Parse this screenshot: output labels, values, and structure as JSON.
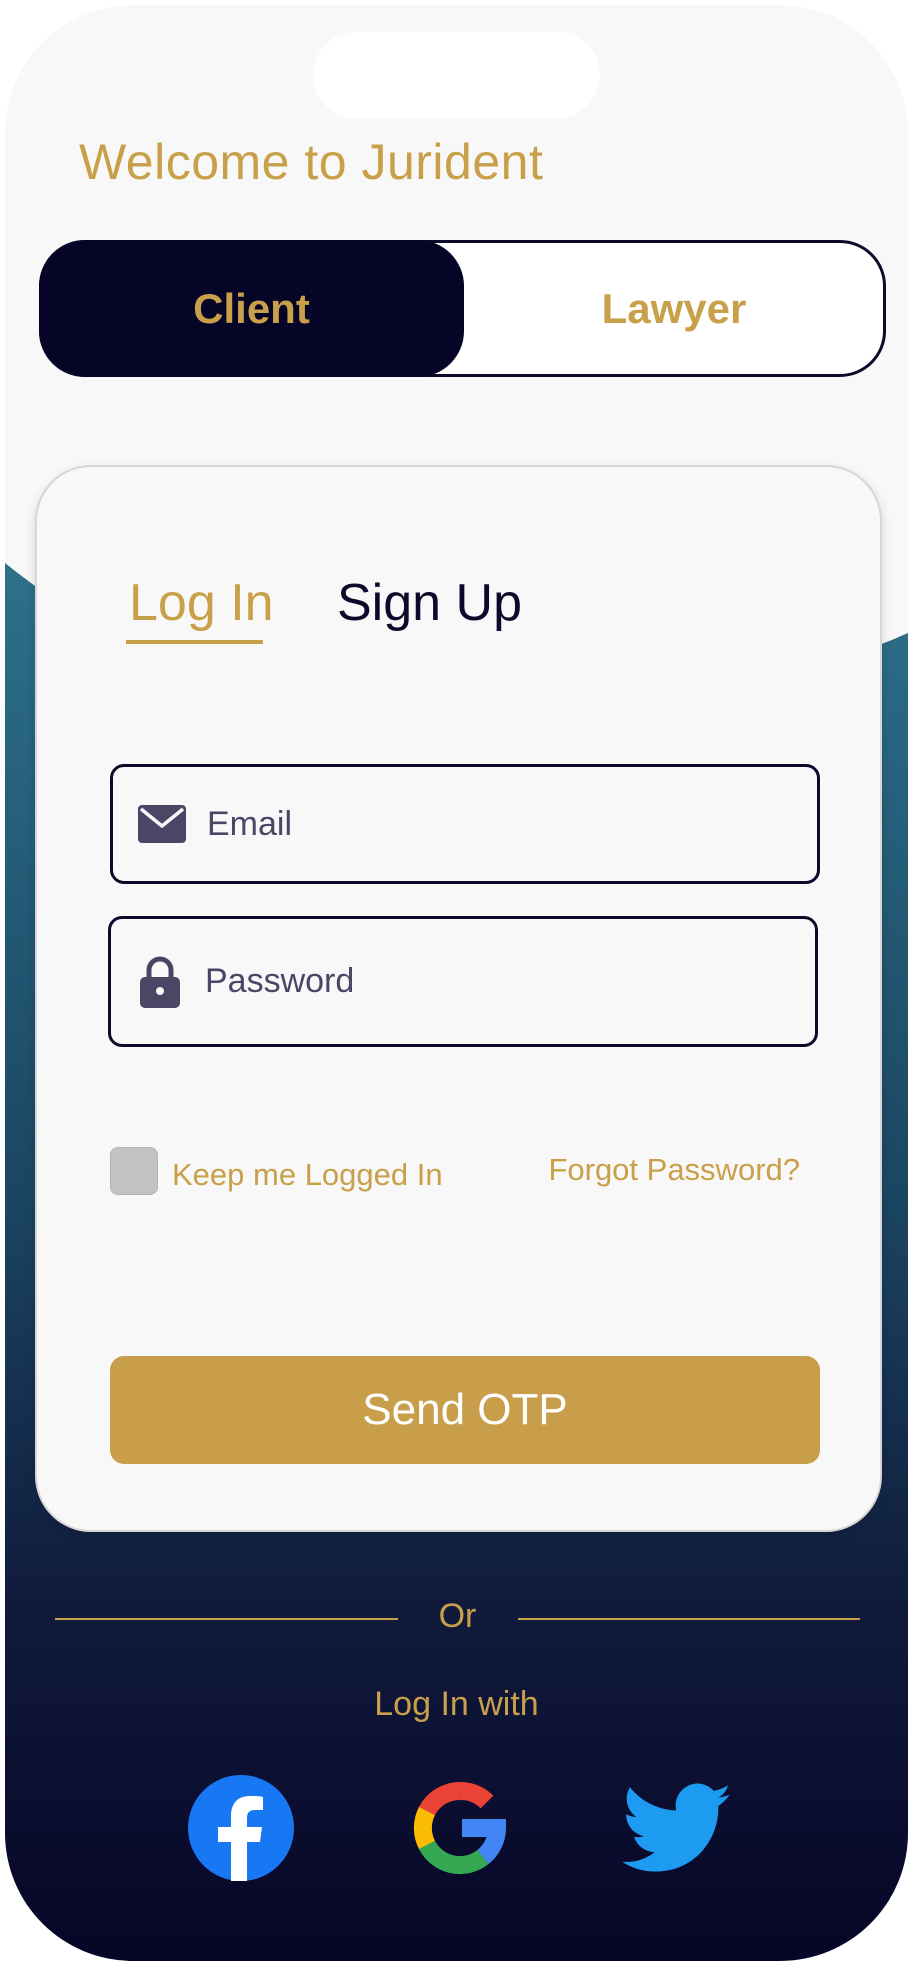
{
  "app": {
    "welcome_title": "Welcome to Jurident"
  },
  "role_switch": {
    "options": [
      {
        "label": "Client",
        "selected": true
      },
      {
        "label": "Lawyer",
        "selected": false
      }
    ]
  },
  "auth_tabs": {
    "login_label": "Log In",
    "signup_label": "Sign Up",
    "active": "Log In"
  },
  "form": {
    "email": {
      "placeholder": "Email",
      "value": "",
      "icon": "mail-icon"
    },
    "password": {
      "placeholder": "Password",
      "value": "",
      "icon": "lock-icon"
    },
    "remember_label": "Keep me Logged In",
    "remember_checked": false,
    "forgot_label": "Forgot Password?",
    "submit_label": "Send OTP"
  },
  "social": {
    "divider_text": "Or",
    "title": "Log In with",
    "providers": [
      "facebook-icon",
      "google-icon",
      "twitter-icon"
    ]
  },
  "colors": {
    "accent_gold": "#c9a04a",
    "navy": "#070527",
    "teal": "#2b6e86",
    "facebook": "#1877f2",
    "twitter": "#1d9bf0"
  }
}
